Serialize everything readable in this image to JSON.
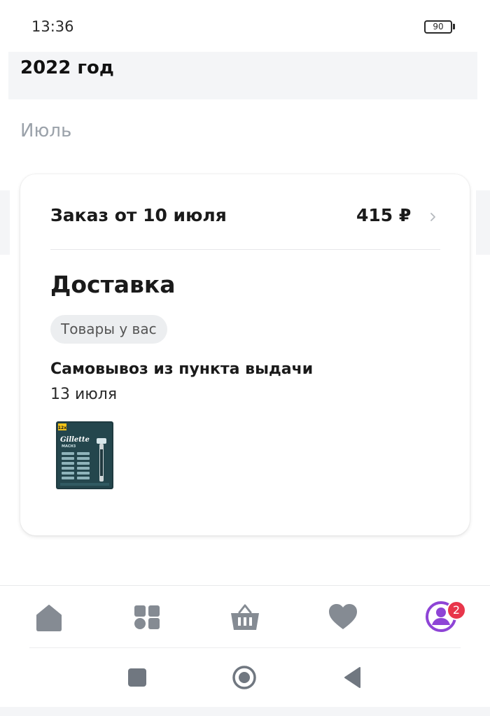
{
  "status_bar": {
    "time": "13:36",
    "battery": "90"
  },
  "header": {
    "year": "2022 год"
  },
  "section": {
    "month": "Июль"
  },
  "order": {
    "title": "Заказ от 10 июля",
    "price": "415 ₽",
    "delivery_heading": "Доставка",
    "status_chip": "Товары у вас",
    "pickup_title": "Самовывоз из пункта выдачи",
    "pickup_date": "13 июля",
    "product": {
      "brand": "Gillette",
      "model": "MACH3",
      "pack_count": "12x"
    }
  },
  "bottom_nav": {
    "items": [
      {
        "icon": "home-icon"
      },
      {
        "icon": "catalog-icon"
      },
      {
        "icon": "cart-icon"
      },
      {
        "icon": "heart-icon"
      },
      {
        "icon": "profile-icon"
      }
    ],
    "profile_badge": "2",
    "colors": {
      "inactive": "#858b93",
      "profile": "#8e44d6",
      "badge": "#e8364b"
    }
  },
  "system_nav": {
    "icons": [
      "recents-icon",
      "home-circle-icon",
      "back-icon"
    ]
  }
}
